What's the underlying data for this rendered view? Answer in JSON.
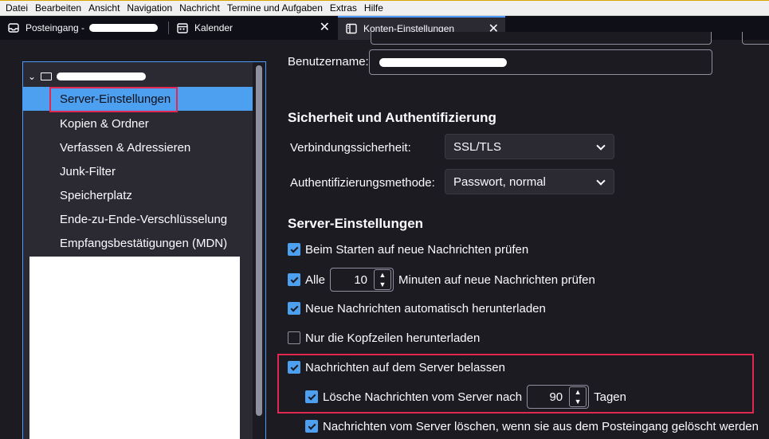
{
  "menubar": [
    {
      "label": "Datei"
    },
    {
      "label": "Bearbeiten"
    },
    {
      "label": "Ansicht"
    },
    {
      "label": "Navigation"
    },
    {
      "label": "Nachricht"
    },
    {
      "label": "Termine und Aufgaben"
    },
    {
      "label": "Extras"
    },
    {
      "label": "Hilfe"
    }
  ],
  "tabs": {
    "inbox": {
      "label": "Posteingang -"
    },
    "calendar": {
      "label": "Kalender"
    },
    "account": {
      "label": "Konten-Einstellungen"
    }
  },
  "tree": {
    "items": [
      {
        "label": "Server-Einstellungen"
      },
      {
        "label": "Kopien & Ordner"
      },
      {
        "label": "Verfassen & Adressieren"
      },
      {
        "label": "Junk-Filter"
      },
      {
        "label": "Speicherplatz"
      },
      {
        "label": "Ende-zu-Ende-Verschlüsselung"
      },
      {
        "label": "Empfangsbestätigungen (MDN)"
      }
    ]
  },
  "settings": {
    "username_label": "Benutzername:",
    "security_heading": "Sicherheit und Authentifizierung",
    "conn_label": "Verbindungssicherheit:",
    "conn_value": "SSL/TLS",
    "auth_label": "Authentifizierungsmethode:",
    "auth_value": "Passwort, normal",
    "server_heading": "Server-Einstellungen",
    "check_on_start": "Beim Starten auf neue Nachrichten prüfen",
    "every_label": "Alle",
    "every_value": "10",
    "every_suffix": "Minuten auf neue Nachrichten prüfen",
    "auto_download": "Neue Nachrichten automatisch herunterladen",
    "headers_only": "Nur die Kopfzeilen herunterladen",
    "leave_on_server": "Nachrichten auf dem Server belassen",
    "delete_after_label": "Lösche Nachrichten vom Server nach",
    "delete_after_value": "90",
    "delete_after_suffix": "Tagen",
    "delete_when_removed": "Nachrichten vom Server löschen, wenn sie aus dem Posteingang gelöscht werden"
  },
  "state": {
    "check_on_start": true,
    "every": true,
    "auto_download": true,
    "headers_only": false,
    "leave_on_server": true,
    "delete_after": true,
    "delete_when_removed": true
  },
  "colors": {
    "accent": "#4d9ff0",
    "highlight_box": "#e22850"
  }
}
